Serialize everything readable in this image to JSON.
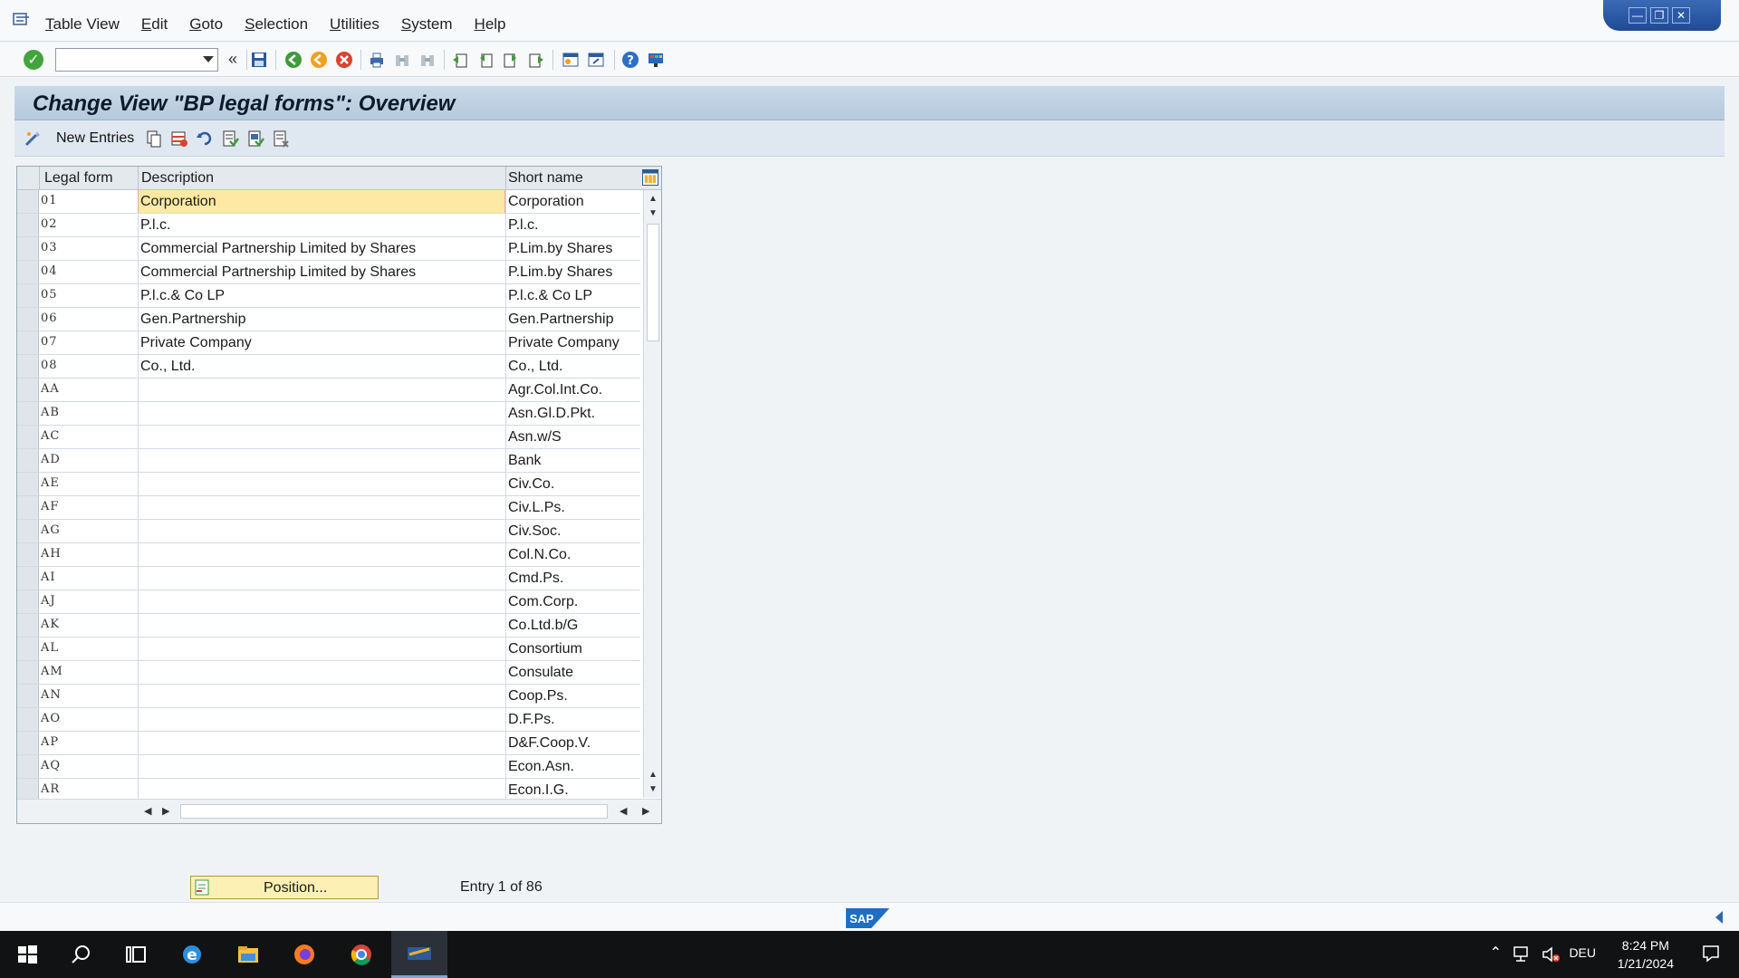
{
  "menubar": {
    "items": [
      "Table View",
      "Edit",
      "Goto",
      "Selection",
      "Utilities",
      "System",
      "Help"
    ]
  },
  "toolbar": {
    "command_field_value": "",
    "icons": [
      "enter-icon",
      "save-icon",
      "back-icon",
      "exit-icon",
      "cancel-icon",
      "print-icon",
      "find-icon",
      "find-next-icon",
      "first-page-icon",
      "previous-page-icon",
      "next-page-icon",
      "last-page-icon",
      "create-session-icon",
      "shortcut-icon",
      "help-icon",
      "customize-layout-icon"
    ]
  },
  "title": "Change View \"BP legal forms\": Overview",
  "app_toolbar": {
    "new_entries": "New Entries",
    "icons": [
      "copy-as-icon",
      "delete-icon",
      "undo-change-icon",
      "select-all-icon",
      "select-block-icon",
      "deselect-all-icon"
    ]
  },
  "table": {
    "headers": {
      "legal_form": "Legal form",
      "description": "Description",
      "short_name": "Short name"
    },
    "rows": [
      {
        "legal_form": "01",
        "description": "Corporation",
        "short_name": "Corporation"
      },
      {
        "legal_form": "02",
        "description": "P.l.c.",
        "short_name": "P.l.c."
      },
      {
        "legal_form": "03",
        "description": "Commercial Partnership Limited by Shares",
        "short_name": "P.Lim.by Shares"
      },
      {
        "legal_form": "04",
        "description": "Commercial Partnership Limited by Shares",
        "short_name": "P.Lim.by Shares"
      },
      {
        "legal_form": "05",
        "description": "P.l.c.& Co LP",
        "short_name": "P.l.c.& Co LP"
      },
      {
        "legal_form": "06",
        "description": "Gen.Partnership",
        "short_name": "Gen.Partnership"
      },
      {
        "legal_form": "07",
        "description": "Private Company",
        "short_name": "Private Company"
      },
      {
        "legal_form": "08",
        "description": "Co., Ltd.",
        "short_name": "Co., Ltd."
      },
      {
        "legal_form": "AA",
        "description": "",
        "short_name": "Agr.Col.Int.Co."
      },
      {
        "legal_form": "AB",
        "description": "",
        "short_name": "Asn.Gl.D.Pkt."
      },
      {
        "legal_form": "AC",
        "description": "",
        "short_name": "Asn.w/S"
      },
      {
        "legal_form": "AD",
        "description": "",
        "short_name": "Bank"
      },
      {
        "legal_form": "AE",
        "description": "",
        "short_name": "Civ.Co."
      },
      {
        "legal_form": "AF",
        "description": "",
        "short_name": "Civ.L.Ps."
      },
      {
        "legal_form": "AG",
        "description": "",
        "short_name": "Civ.Soc."
      },
      {
        "legal_form": "AH",
        "description": "",
        "short_name": "Col.N.Co."
      },
      {
        "legal_form": "AI",
        "description": "",
        "short_name": "Cmd.Ps."
      },
      {
        "legal_form": "AJ",
        "description": "",
        "short_name": "Com.Corp."
      },
      {
        "legal_form": "AK",
        "description": "",
        "short_name": "Co.Ltd.b/G"
      },
      {
        "legal_form": "AL",
        "description": "",
        "short_name": "Consortium"
      },
      {
        "legal_form": "AM",
        "description": "",
        "short_name": "Consulate"
      },
      {
        "legal_form": "AN",
        "description": "",
        "short_name": "Coop.Ps."
      },
      {
        "legal_form": "AO",
        "description": "",
        "short_name": "D.F.Ps."
      },
      {
        "legal_form": "AP",
        "description": "",
        "short_name": "D&F.Coop.V."
      },
      {
        "legal_form": "AQ",
        "description": "",
        "short_name": "Econ.Asn."
      },
      {
        "legal_form": "AR",
        "description": "",
        "short_name": "Econ.I.G."
      }
    ]
  },
  "position_button": "Position...",
  "entry_info": "Entry 1 of 86",
  "statusbar": {
    "logo": "SAP"
  },
  "taskbar": {
    "language": "DEU",
    "time": "8:24 PM",
    "date": "1/21/2024"
  },
  "colors": {
    "title_bg": "#c9d9e8",
    "selected_cell": "#fde9a3",
    "position_button": "#fdf0b4",
    "taskbar": "#111214"
  }
}
